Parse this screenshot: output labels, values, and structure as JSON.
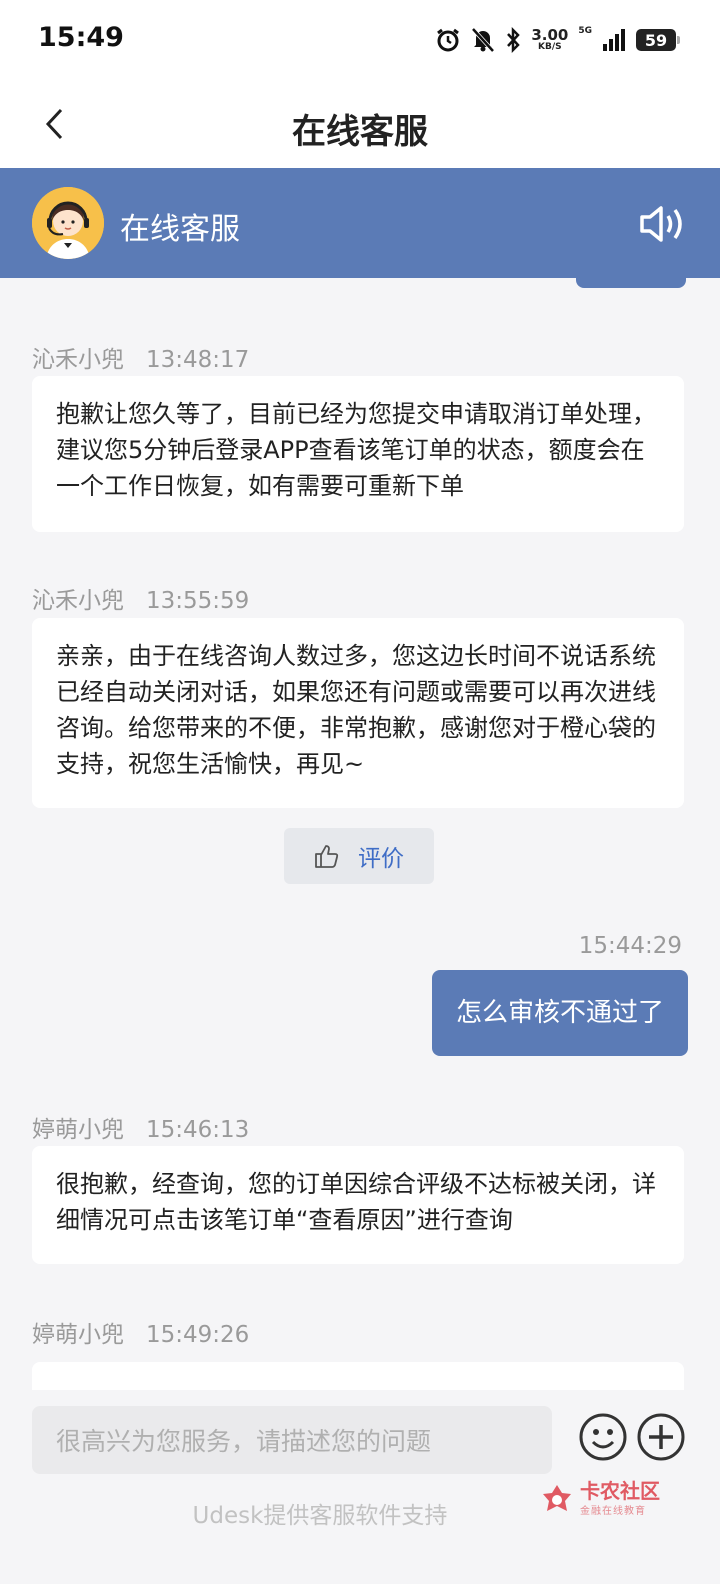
{
  "status_bar": {
    "time": "15:49",
    "net_speed": "3.00",
    "net_unit": "KB/S",
    "network": "5G",
    "battery": "59"
  },
  "nav": {
    "title": "在线客服"
  },
  "agent_bar": {
    "name": "在线客服"
  },
  "messages": [
    {
      "sender": "沁禾小兜",
      "time": "13:48:17",
      "text": "抱歉让您久等了，目前已经为您提交申请取消订单处理，建议您5分钟后登录APP查看该笔订单的状态，额度会在一个工作日恢复，如有需要可重新下单"
    },
    {
      "sender": "沁禾小兜",
      "time": "13:55:59",
      "text": "亲亲，由于在线咨询人数过多，您这边长时间不说话系统已经自动关闭对话，如果您还有问题或需要可以再次进线咨询。给您带来的不便，非常抱歉，感谢您对于橙心袋的支持，祝您生活愉快，再见~"
    },
    {
      "sender": "婷萌小兜",
      "time": "15:46:13",
      "text": "很抱歉，经查询，您的订单因综合评级不达标被关闭，详细情况可点击该笔订单“查看原因”进行查询"
    },
    {
      "sender": "婷萌小兜",
      "time": "15:49:26",
      "text": ""
    }
  ],
  "rating_button": {
    "label": "评价"
  },
  "my_message": {
    "time": "15:44:29",
    "text": "怎么审核不通过了"
  },
  "input": {
    "placeholder": "很高兴为您服务，请描述您的问题"
  },
  "footer": {
    "text": "Udesk提供客服软件支持"
  },
  "watermark": {
    "main": "卡农社区",
    "sub": "金融在线教育"
  },
  "colors": {
    "accent": "#5b7bb6",
    "link": "#3f6dc6",
    "background": "#f5f5f7"
  }
}
